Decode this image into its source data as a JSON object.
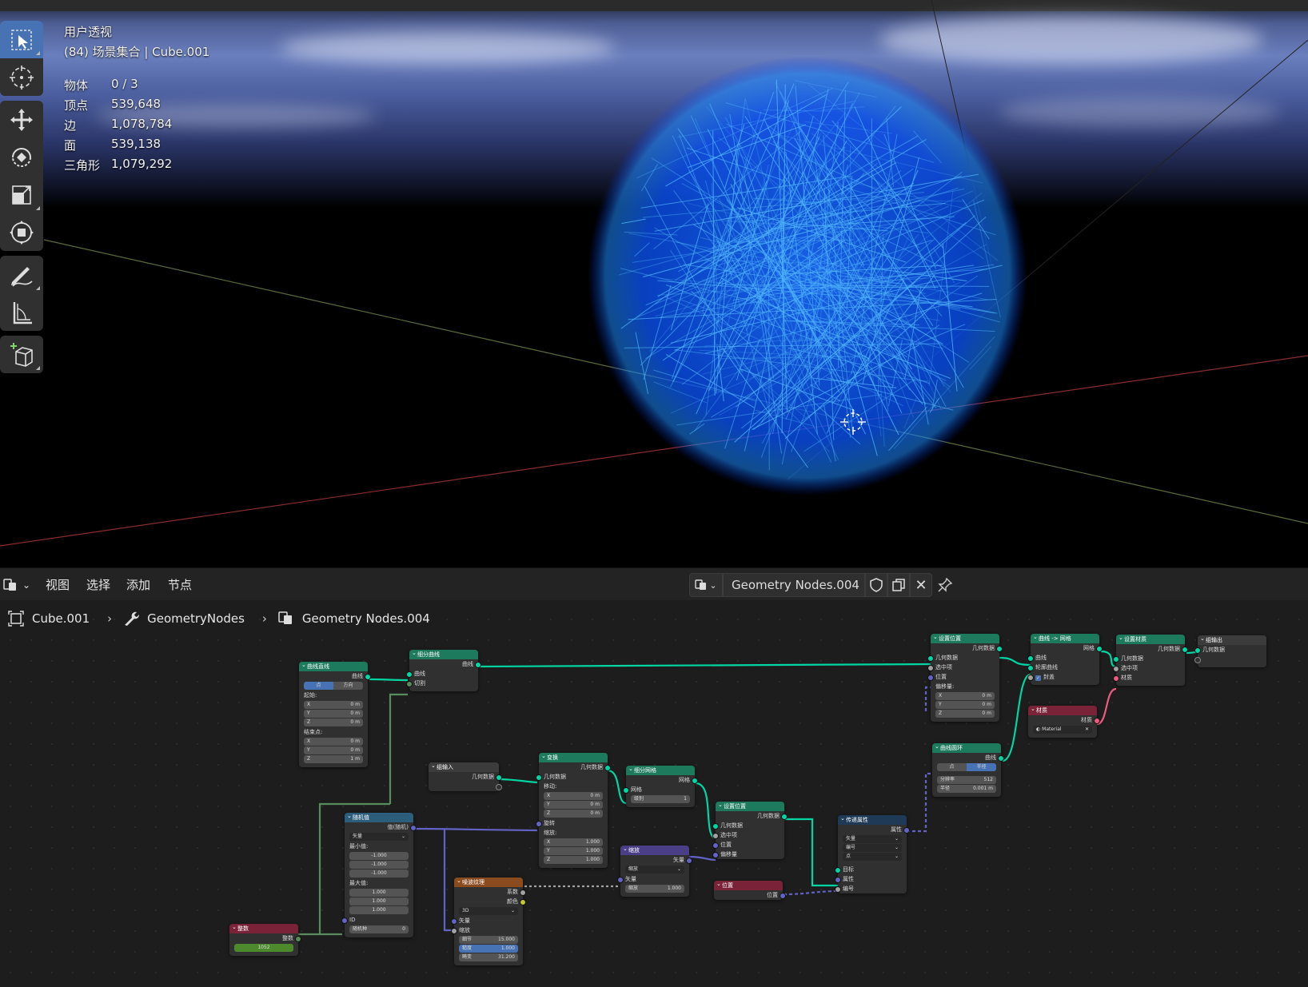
{
  "viewport": {
    "view_name": "用户透视",
    "collection_line": "(84) 场景集合 | Cube.001",
    "stats": [
      {
        "label": "物体",
        "value": "0 / 3"
      },
      {
        "label": "顶点",
        "value": "539,648"
      },
      {
        "label": "边",
        "value": "1,078,784"
      },
      {
        "label": "面",
        "value": "539,138"
      },
      {
        "label": "三角形",
        "value": "1,079,292"
      }
    ],
    "tools": [
      "select-box-icon",
      "cursor-icon",
      "move-icon",
      "rotate-icon",
      "scale-icon",
      "transform-icon",
      "annotate-icon",
      "measure-icon",
      "add-cube-icon"
    ]
  },
  "node_editor": {
    "menu": [
      "视图",
      "选择",
      "添加",
      "节点"
    ],
    "datablock_name": "Geometry Nodes.004",
    "breadcrumb": [
      "Cube.001",
      "GeometryNodes",
      "Geometry Nodes.004"
    ],
    "nodes": {
      "curve_line": {
        "title": "曲线直线",
        "out": "曲线",
        "mode": [
          "点",
          "方向"
        ],
        "start": "起始:",
        "end": "结束点:",
        "sx": "0 m",
        "sy": "0 m",
        "sz": "0 m",
        "ex": "0 m",
        "ey": "0 m",
        "ez": "1 m"
      },
      "resample": {
        "title": "细分曲线",
        "out": "曲线",
        "in1": "曲线",
        "in2": "切割"
      },
      "group_input": {
        "title": "组输入",
        "out": "几何数据"
      },
      "transform": {
        "title": "变换",
        "out": "几何数据",
        "geo": "几何数据",
        "move": "移动:",
        "mx": "0 m",
        "my": "0 m",
        "mz": "0 m",
        "rot": "旋转",
        "scale": "缩放:",
        "sx": "1.000",
        "sy": "1.000",
        "sz": "1.000"
      },
      "subdivide": {
        "title": "细分网格",
        "out": "网格",
        "in": "网格",
        "level_label": "级别",
        "level": "1"
      },
      "random": {
        "title": "随机值",
        "out": "值(随机)",
        "type": "矢量",
        "min": "最小值:",
        "minx": "-1.000",
        "miny": "-1.000",
        "minz": "-1.000",
        "max": "最大值:",
        "maxx": "1.000",
        "maxy": "1.000",
        "maxz": "1.000",
        "id": "ID",
        "seed_label": "随机种",
        "seed": "0"
      },
      "integer": {
        "title": "整数",
        "out": "整数",
        "value": "1052"
      },
      "noise": {
        "title": "噪波纹理",
        "out1": "系数",
        "out2": "颜色",
        "dim": "3D",
        "vec": "矢量",
        "scale_lbl": "缩放",
        "detail_lbl": "细节",
        "detail": "15.000",
        "rough_lbl": "糙度",
        "rough": "1.000",
        "distort_lbl": "畸变",
        "distort": "31.200"
      },
      "scale": {
        "title": "缩放",
        "out": "矢量",
        "mode": "缩放",
        "vec": "矢量",
        "scale_lbl": "缩放",
        "scale": "1.000"
      },
      "set_position": {
        "title": "设置位置",
        "out": "几何数据",
        "geo": "几何数据",
        "sel": "选中项",
        "pos": "位置",
        "off": "偏移量"
      },
      "position": {
        "title": "位置",
        "out": "位置"
      },
      "transfer": {
        "title": "传递属性",
        "out": "属性",
        "d1": "矢量",
        "d2": "编号",
        "d3": "点",
        "tgt": "目标",
        "attr": "属性",
        "idx": "编号"
      },
      "set_position2": {
        "title": "设置位置",
        "out": "几何数据",
        "geo": "几何数据",
        "sel": "选中项",
        "pos": "位置",
        "off": "偏移量:",
        "x": "0 m",
        "y": "0 m",
        "z": "0 m"
      },
      "curve_circle": {
        "title": "曲线圆环",
        "out": "曲线",
        "mode": [
          "点",
          "半径"
        ],
        "res_lbl": "分辨率",
        "res": "512",
        "rad_lbl": "半径",
        "rad": "0.001 m"
      },
      "curve_to_mesh": {
        "title": "曲线 -> 网格",
        "out": "网格",
        "in1": "曲线",
        "in2": "轮廓曲线",
        "fill": "封盖"
      },
      "material": {
        "title": "材质",
        "out": "材质",
        "value": "Material"
      },
      "set_material": {
        "title": "设置材质",
        "out": "几何数据",
        "geo": "几何数据",
        "sel": "选中项",
        "mat": "材质"
      },
      "group_output": {
        "title": "组输出",
        "in": "几何数据"
      }
    }
  }
}
